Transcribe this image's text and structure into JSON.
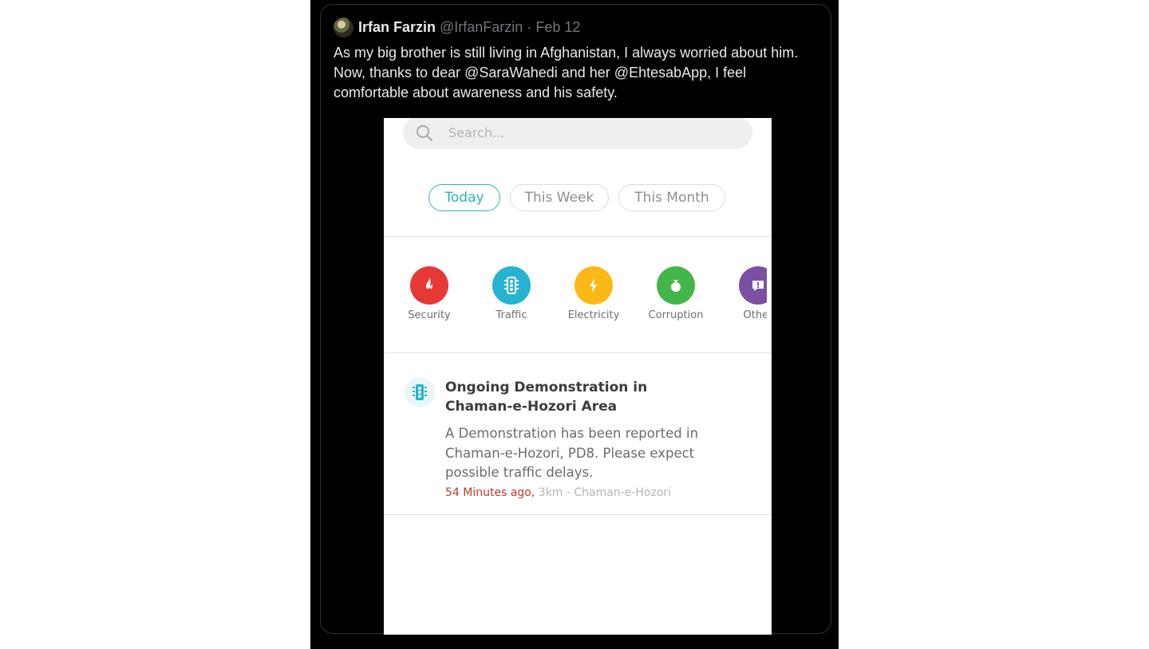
{
  "tweet": {
    "author_name": "Irfan Farzin",
    "author_handle": "@IrfanFarzin",
    "separator": "·",
    "date": "Feb 12",
    "text": "As my big brother is still living in Afghanistan, I always worried about him. Now, thanks to dear @SaraWahedi and her @EhtesabApp, I feel comfortable about awareness and his safety."
  },
  "app": {
    "search": {
      "placeholder": "Search..."
    },
    "filters": [
      {
        "label": "Today",
        "active": true
      },
      {
        "label": "This Week",
        "active": false
      },
      {
        "label": "This Month",
        "active": false
      }
    ],
    "categories": [
      {
        "label": "Security",
        "icon": "fire-icon",
        "color": "#e53935"
      },
      {
        "label": "Traffic",
        "icon": "traffic-light-icon",
        "color": "#26b3d1"
      },
      {
        "label": "Electricity",
        "icon": "lightning-icon",
        "color": "#fbb917"
      },
      {
        "label": "Corruption",
        "icon": "money-bag-icon",
        "color": "#43b649"
      },
      {
        "label": "Other",
        "icon": "exclamation-icon",
        "color": "#7b4fa2"
      }
    ],
    "report": {
      "icon": "traffic-light-icon",
      "title": "Ongoing Demonstration in Chaman-e-Hozori Area",
      "body": "A Demonstration has been reported in Chaman-e-Hozori, PD8. Please expect possible traffic delays.",
      "time": "54 Minutes ago,",
      "location": " 3km - Chaman-e-Hozori"
    }
  },
  "colors": {
    "accent": "#2bb5b0",
    "time_red": "#c0392b",
    "tweet_bg": "#000000"
  }
}
